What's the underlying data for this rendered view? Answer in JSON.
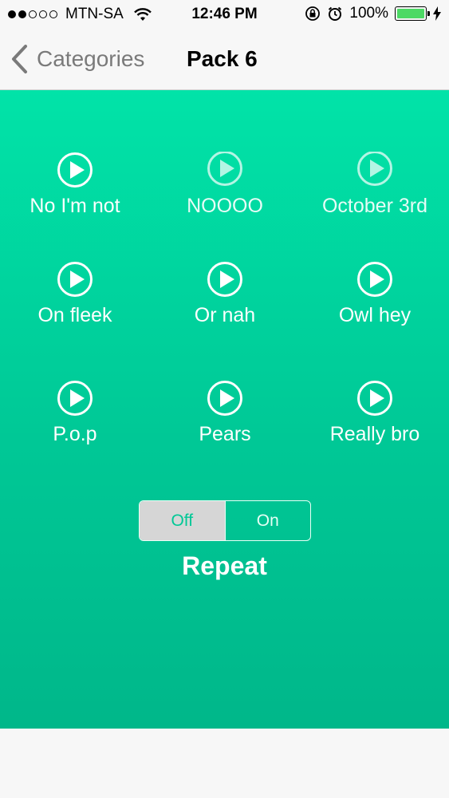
{
  "status_bar": {
    "carrier": "MTN-SA",
    "time": "12:46 PM",
    "battery": "100%",
    "battery_color": "#4cd964",
    "icons": [
      "signal-dots-icon",
      "wifi-icon",
      "rotation-lock-icon",
      "alarm-icon",
      "battery-icon",
      "charging-bolt-icon"
    ]
  },
  "nav": {
    "back_label": "Categories",
    "title": "Pack 6"
  },
  "sounds": [
    {
      "label": "No I'm not"
    },
    {
      "label": "NOOOO"
    },
    {
      "label": "October 3rd"
    },
    {
      "label": "On fleek"
    },
    {
      "label": "Or nah"
    },
    {
      "label": "Owl hey"
    },
    {
      "label": "P.o.p"
    },
    {
      "label": "Pears"
    },
    {
      "label": "Really bro"
    }
  ],
  "repeat": {
    "off_label": "Off",
    "on_label": "On",
    "selected": "Off",
    "label": "Repeat"
  },
  "colors": {
    "accent_green": "#00c896",
    "top_green": "#01e3a8"
  }
}
